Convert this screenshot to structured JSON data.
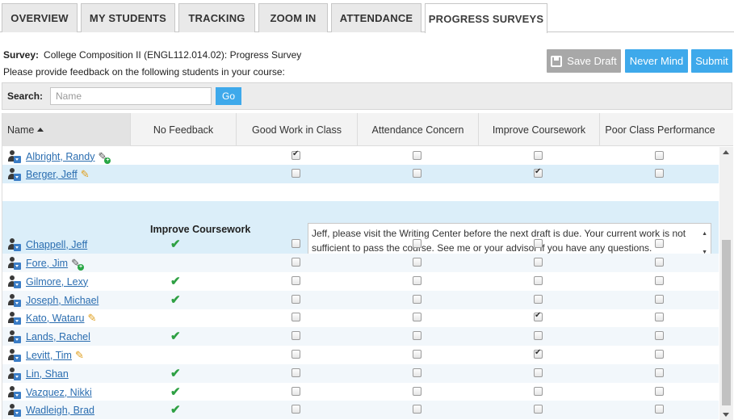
{
  "tabs": [
    {
      "label": "OVERVIEW",
      "active": false
    },
    {
      "label": "MY STUDENTS",
      "active": false
    },
    {
      "label": "TRACKING",
      "active": false
    },
    {
      "label": "ZOOM IN",
      "active": false
    },
    {
      "label": "ATTENDANCE",
      "active": false
    },
    {
      "label": "PROGRESS SURVEYS",
      "active": true
    }
  ],
  "survey": {
    "label": "Survey:",
    "name": "College Composition II (ENGL112.014.02): Progress Survey",
    "instructions": "Please provide feedback on the following students in your course:"
  },
  "buttons": {
    "save_draft": "Save Draft",
    "never_mind": "Never Mind",
    "submit": "Submit"
  },
  "search": {
    "label": "Search:",
    "placeholder": "Name",
    "go": "Go"
  },
  "columns": [
    "Name",
    "No Feedback",
    "Good Work in Class",
    "Attendance Concern",
    "Improve Coursework",
    "Poor Class Performance"
  ],
  "students": [
    {
      "name": "Albright, Randy",
      "note": "add",
      "no_feedback": false,
      "good": true,
      "attendance": false,
      "improve": false,
      "poor": false
    },
    {
      "name": "Berger, Jeff",
      "note": "edit",
      "no_feedback": false,
      "good": false,
      "attendance": false,
      "improve": true,
      "poor": false,
      "selected": true
    },
    {
      "name": "Chappell, Jeff",
      "note": "",
      "no_feedback": true,
      "good": false,
      "attendance": false,
      "improve": false,
      "poor": false
    },
    {
      "name": "Fore, Jim",
      "note": "add",
      "no_feedback": false,
      "good": false,
      "attendance": false,
      "improve": false,
      "poor": false
    },
    {
      "name": "Gilmore, Lexy",
      "note": "",
      "no_feedback": true,
      "good": false,
      "attendance": false,
      "improve": false,
      "poor": false
    },
    {
      "name": "Joseph, Michael",
      "note": "",
      "no_feedback": true,
      "good": false,
      "attendance": false,
      "improve": false,
      "poor": false
    },
    {
      "name": "Kato, Wataru",
      "note": "edit",
      "no_feedback": false,
      "good": false,
      "attendance": false,
      "improve": true,
      "poor": false
    },
    {
      "name": "Lands, Rachel",
      "note": "",
      "no_feedback": true,
      "good": false,
      "attendance": false,
      "improve": false,
      "poor": false
    },
    {
      "name": "Levitt, Tim",
      "note": "edit",
      "no_feedback": false,
      "good": false,
      "attendance": false,
      "improve": true,
      "poor": false
    },
    {
      "name": "Lin, Shan",
      "note": "",
      "no_feedback": true,
      "good": false,
      "attendance": false,
      "improve": false,
      "poor": false
    },
    {
      "name": "Vazquez, Nikki",
      "note": "",
      "no_feedback": true,
      "good": false,
      "attendance": false,
      "improve": false,
      "poor": false
    },
    {
      "name": "Wadleigh, Brad",
      "note": "",
      "no_feedback": true,
      "good": false,
      "attendance": false,
      "improve": false,
      "poor": false
    }
  ],
  "detail": {
    "label": "Improve Coursework",
    "comment": "Jeff, please visit the Writing Center before the next draft is due. Your current work is not sufficient to pass the course. See me or your advisor if you have any questions."
  },
  "colors": {
    "accent": "#3ea9eb",
    "selected_row": "#dbeef9",
    "check_green": "#2ea043",
    "link": "#2a6db0"
  }
}
